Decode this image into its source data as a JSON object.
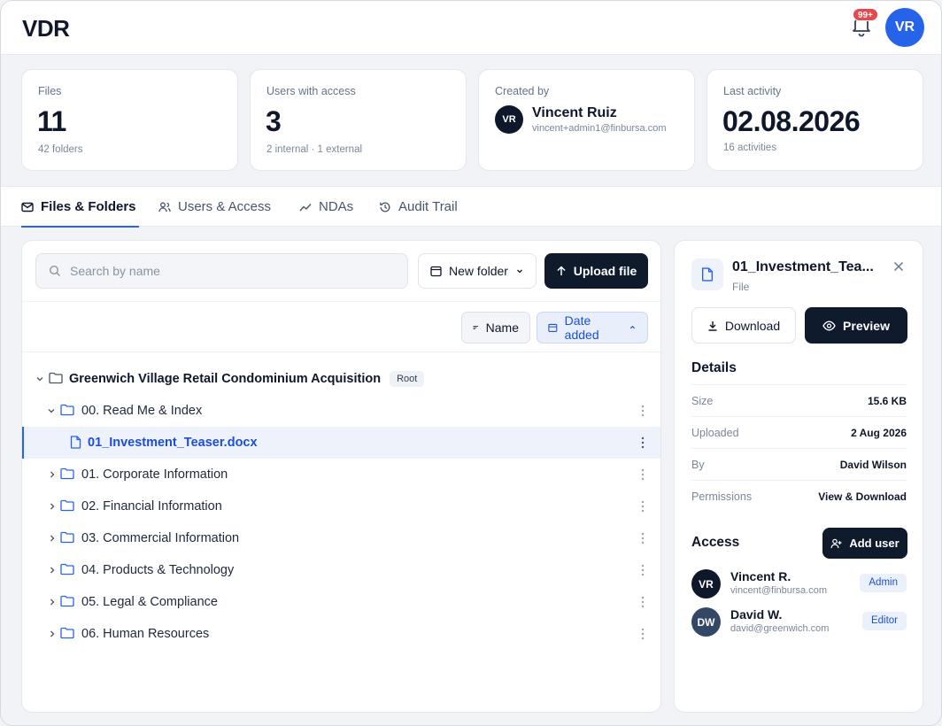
{
  "app": {
    "title": "VDR",
    "notifications": "99+",
    "user_initials": "VR"
  },
  "stats": {
    "files": {
      "label": "Files",
      "value": "11",
      "sub": "42 folders"
    },
    "users": {
      "label": "Users with access",
      "value": "3",
      "sub": "2 internal · 1 external"
    },
    "creator": {
      "label": "Created by",
      "initials": "VR",
      "name": "Vincent Ruiz",
      "email": "vincent+admin1@finbursa.com"
    },
    "activity": {
      "label": "Last activity",
      "value": "02.08.2026",
      "sub": "16 activities"
    }
  },
  "tabs": [
    {
      "label": "Files & Folders",
      "icon": "mail-icon"
    },
    {
      "label": "Users & Access",
      "icon": "users-icon"
    },
    {
      "label": "NDAs",
      "icon": "trend-icon"
    },
    {
      "label": "Audit Trail",
      "icon": "history-icon"
    }
  ],
  "toolbar": {
    "search_placeholder": "Search by name",
    "new_folder": "New folder",
    "upload": "Upload file"
  },
  "sort": {
    "name": "Name",
    "date": "Date added"
  },
  "tree": {
    "root": {
      "label": "Greenwich Village Retail Condominium Acquisition",
      "badge": "Root"
    },
    "items": [
      {
        "label": "00. Read Me & Index",
        "type": "folder",
        "expanded": true,
        "level": 1
      },
      {
        "label": "01_Investment_Teaser.docx",
        "type": "file",
        "level": 2,
        "selected": true
      },
      {
        "label": "01. Corporate Information",
        "type": "folder",
        "level": 1
      },
      {
        "label": "02. Financial Information",
        "type": "folder",
        "level": 1
      },
      {
        "label": "03. Commercial Information",
        "type": "folder",
        "level": 1
      },
      {
        "label": "04. Products & Technology",
        "type": "folder",
        "level": 1
      },
      {
        "label": "05. Legal & Compliance",
        "type": "folder",
        "level": 1
      },
      {
        "label": "06. Human Resources",
        "type": "folder",
        "level": 1
      }
    ]
  },
  "detail": {
    "title": "01_Investment_Teaser.docx",
    "title_display": "01_Investment_Tea...",
    "type": "File",
    "download": "Download",
    "preview": "Preview",
    "details_heading": "Details",
    "rows": [
      {
        "k": "Size",
        "v": "15.6 KB"
      },
      {
        "k": "Uploaded",
        "v": "2 Aug 2026"
      },
      {
        "k": "By",
        "v": "David Wilson"
      },
      {
        "k": "Permissions",
        "v": "View & Download"
      }
    ],
    "access_heading": "Access",
    "add_user": "Add user",
    "users": [
      {
        "initials": "VR",
        "name": "Vincent R.",
        "email": "vincent@finbursa.com",
        "role": "Admin",
        "color": "#0f172a"
      },
      {
        "initials": "DW",
        "name": "David W.",
        "email": "david@greenwich.com",
        "role": "Editor",
        "color": "#334766"
      }
    ]
  },
  "colors": {
    "accent": "#2563eb",
    "dark_button": "#0f1b2d",
    "badge_red": "#e5484d"
  }
}
